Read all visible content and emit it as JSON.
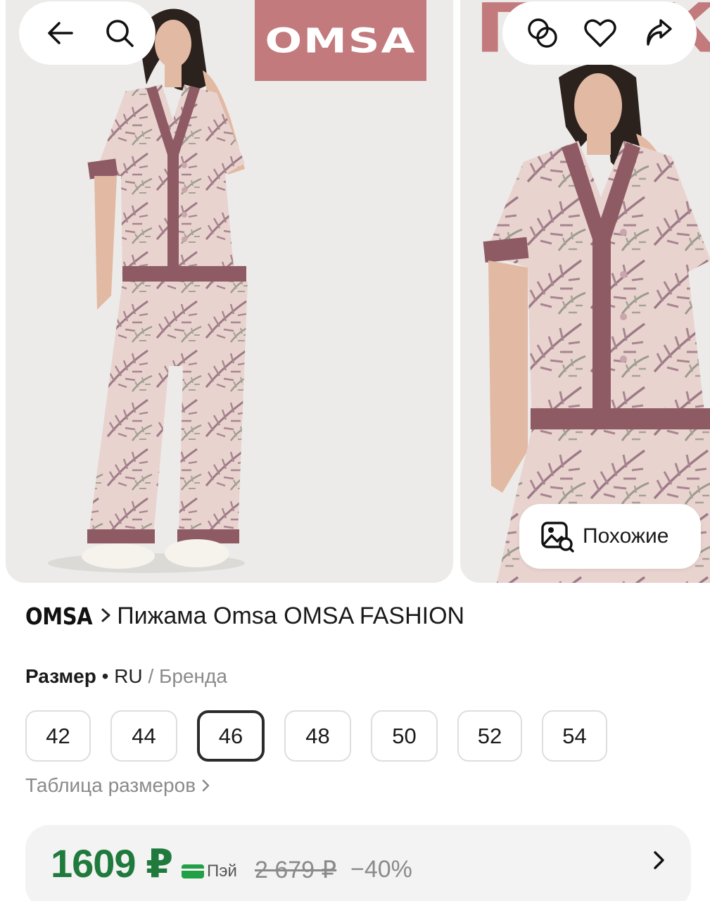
{
  "gallery": {
    "logo_text": "OMSA",
    "similar_label": "Похожие",
    "icons": {
      "back": "arrow-left-icon",
      "search": "search-icon",
      "compare": "compare-icon",
      "favorite": "heart-icon",
      "share": "share-icon",
      "similar": "image-search-icon"
    }
  },
  "product": {
    "brand": "OMSA",
    "name": "Пижама Omsa OMSA FASHION"
  },
  "size": {
    "label": "Размер",
    "system": "• RU",
    "alt_system": "/ Бренда",
    "options": [
      "42",
      "44",
      "46",
      "48",
      "50",
      "52",
      "54"
    ],
    "selected": "46",
    "table_link": "Таблица размеров"
  },
  "price": {
    "current": "1609 ₽",
    "pay_label": "Пэй",
    "old": "2 679 ₽",
    "discount": "−40%"
  },
  "colors": {
    "price_green": "#1f7a3c",
    "pay_green": "#22a046",
    "logo_pink": "#c27a7d",
    "trim_mauve": "#8e5b64"
  }
}
